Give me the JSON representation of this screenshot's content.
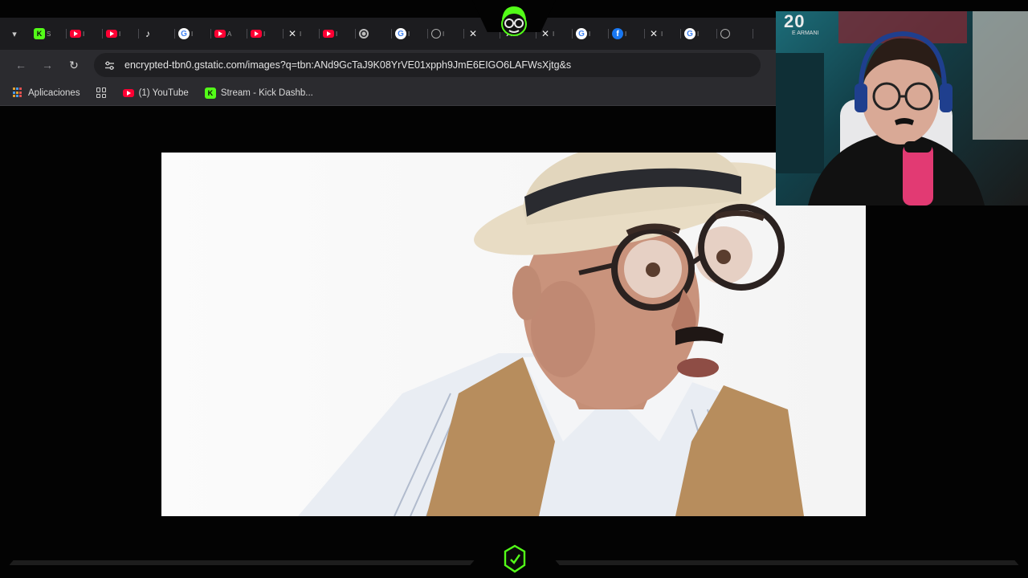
{
  "browser": {
    "tabs": [
      {
        "icon": "kick-icon",
        "label": "S"
      },
      {
        "icon": "youtube-icon",
        "label": "I"
      },
      {
        "icon": "youtube-icon",
        "label": "I"
      },
      {
        "icon": "tiktok-icon",
        "label": ""
      },
      {
        "icon": "google-icon",
        "label": "I"
      },
      {
        "icon": "youtube-icon",
        "label": "A"
      },
      {
        "icon": "youtube-icon",
        "label": "I"
      },
      {
        "icon": "x-icon",
        "label": "I"
      },
      {
        "icon": "youtube-icon",
        "label": "I"
      },
      {
        "icon": "chrome-icon",
        "label": ""
      },
      {
        "icon": "google-icon",
        "label": "I"
      },
      {
        "icon": "globe-icon",
        "label": "I"
      },
      {
        "icon": "x-icon",
        "label": ""
      },
      {
        "icon": "x-icon",
        "label": "I"
      },
      {
        "icon": "x-icon",
        "label": "I"
      },
      {
        "icon": "google-icon",
        "label": "I"
      },
      {
        "icon": "facebook-icon",
        "label": "I"
      },
      {
        "icon": "x-icon",
        "label": "I"
      },
      {
        "icon": "google-icon",
        "label": "I"
      },
      {
        "icon": "globe-icon",
        "label": ""
      }
    ],
    "url": "encrypted-tbn0.gstatic.com/images?q=tbn:ANd9GcTaJ9K08YrVE01xpph9JmE6EIGO6LAFWsXjtg&s",
    "bookmarks": {
      "apps": "Aplicaciones",
      "youtube": "(1) YouTube",
      "kick": "Stream - Kick Dashb..."
    }
  },
  "webcam": {
    "jersey_number": "20",
    "jersey_name": "E ARMANI"
  },
  "colors": {
    "kick_green": "#53fc18",
    "youtube_red": "#ff0033",
    "chrome_tabstrip": "#1c1c1f",
    "chrome_toolbar": "#2b2b2f",
    "background": "#030303"
  }
}
